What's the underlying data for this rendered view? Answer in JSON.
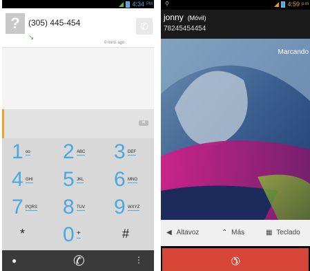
{
  "left_phone": {
    "status_time": "4:34",
    "status_ampm": "PM",
    "call_log": {
      "number": "(305) 445-454",
      "time_ago": "0 mins ago",
      "avatar_glyph": "?"
    },
    "keys": [
      {
        "num": "1",
        "sub": "oo"
      },
      {
        "num": "2",
        "sub": "ABC"
      },
      {
        "num": "3",
        "sub": "DEF"
      },
      {
        "num": "4",
        "sub": "GHI"
      },
      {
        "num": "5",
        "sub": "JKL"
      },
      {
        "num": "6",
        "sub": "MNO"
      },
      {
        "num": "7",
        "sub": "PQRS"
      },
      {
        "num": "8",
        "sub": "TUV"
      },
      {
        "num": "9",
        "sub": "WXYZ"
      },
      {
        "num": "*",
        "sub": ""
      },
      {
        "num": "0",
        "sub": "+"
      },
      {
        "num": "#",
        "sub": ""
      }
    ],
    "colors": {
      "accent": "#4aa8e0",
      "orange": "#f39c2a"
    }
  },
  "right_phone": {
    "status_time": "4:59",
    "status_ampm": "p.m",
    "contact_name": "jonny",
    "contact_type": "(Móvil)",
    "contact_number": "78245454454",
    "call_state": "Marcando",
    "actions": {
      "speaker": "Altavoz",
      "more": "Más",
      "keypad": "Teclado"
    },
    "colors": {
      "hangup": "#d74637"
    }
  }
}
